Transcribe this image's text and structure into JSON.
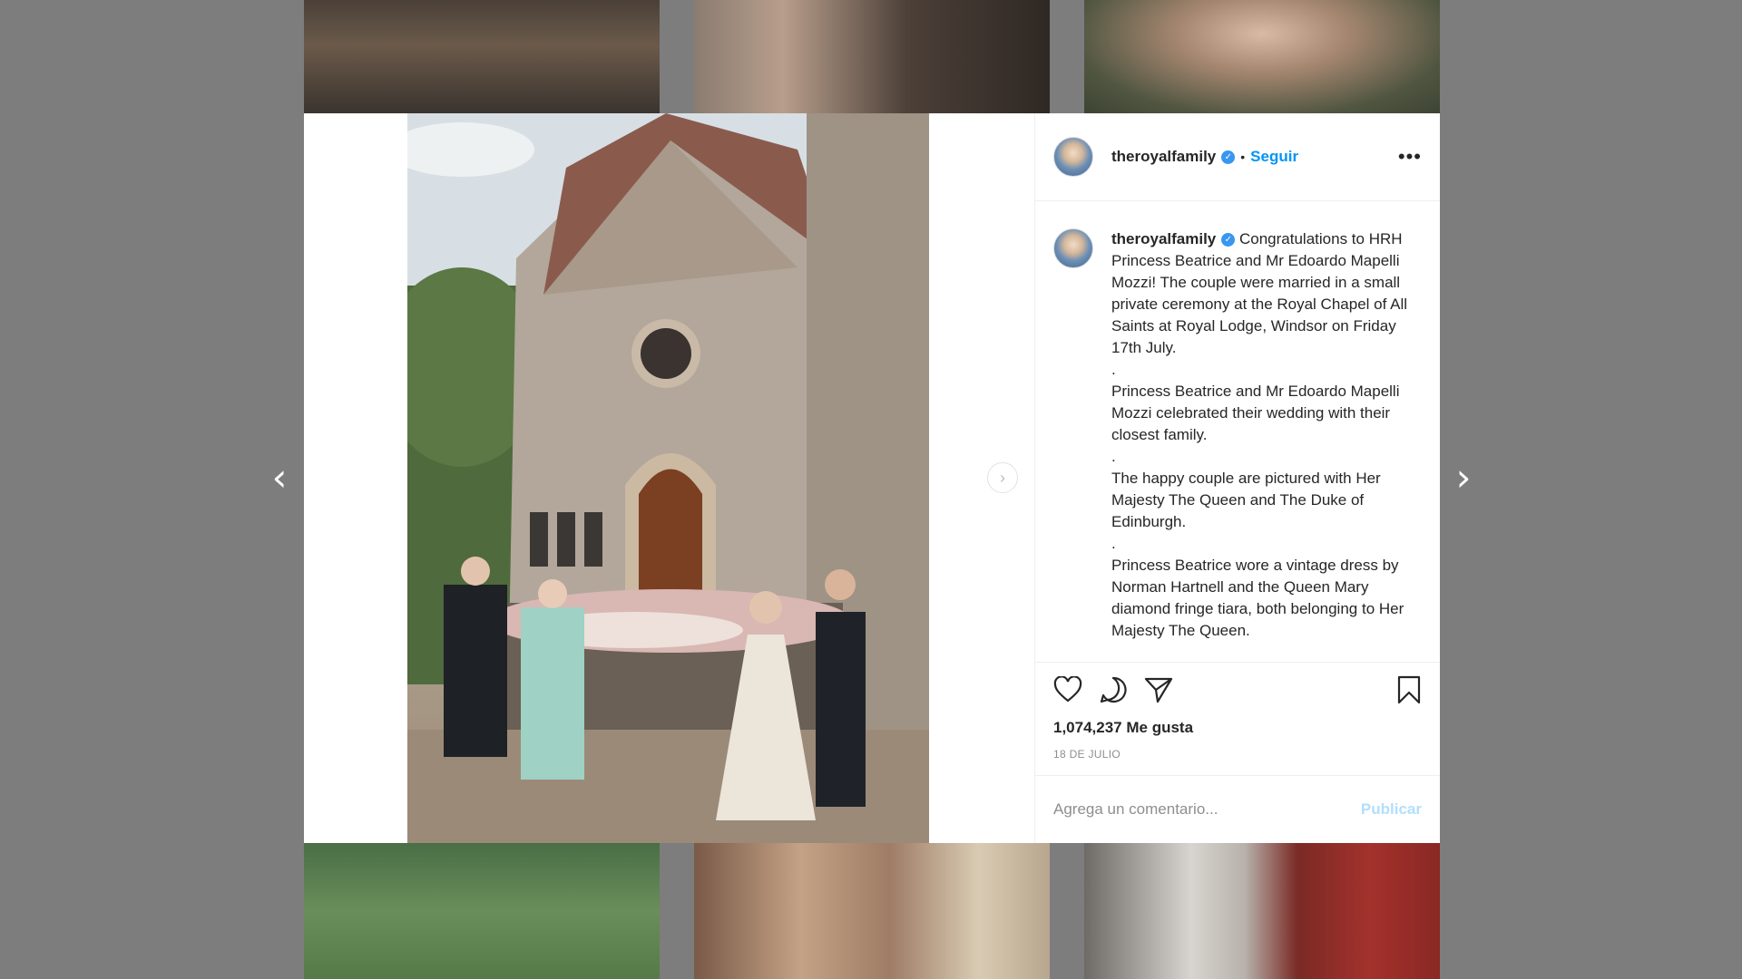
{
  "post": {
    "username": "theroyalfamily",
    "follow_label": "Seguir",
    "separator": "•",
    "more_label": "•••",
    "caption": [
      "Congratulations to HRH Princess Beatrice and Mr Edoardo Mapelli Mozzi! The couple were married in a small private ceremony at the Royal Chapel of All Saints at Royal Lodge, Windsor on Friday 17th July.",
      ".",
      "Princess Beatrice and Mr Edoardo Mapelli Mozzi celebrated their wedding with their closest family.",
      ".",
      "The happy couple are pictured with Her Majesty The Queen and The Duke of Edinburgh.",
      ".",
      "Princess Beatrice wore a vintage dress by Norman Hartnell and the Queen Mary diamond fringe tiara, both belonging to Her Majesty The Queen."
    ],
    "likes": "1,074,237 Me gusta",
    "date": "18 DE JULIO",
    "comment_placeholder": "Agrega un comentario...",
    "publish_label": "Publicar"
  },
  "icons": {
    "verified": "verified-badge-icon",
    "like": "heart-icon",
    "comment": "comment-bubble-icon",
    "share": "paper-plane-icon",
    "save": "bookmark-icon",
    "prev": "chevron-left-icon",
    "next": "chevron-right-icon"
  },
  "colors": {
    "accent": "#0095f6",
    "verified": "#3897f0",
    "publish_disabled": "#b2dffc",
    "overlay": "#7d7d7d"
  },
  "carousel": {
    "current": 1,
    "total": 2
  }
}
